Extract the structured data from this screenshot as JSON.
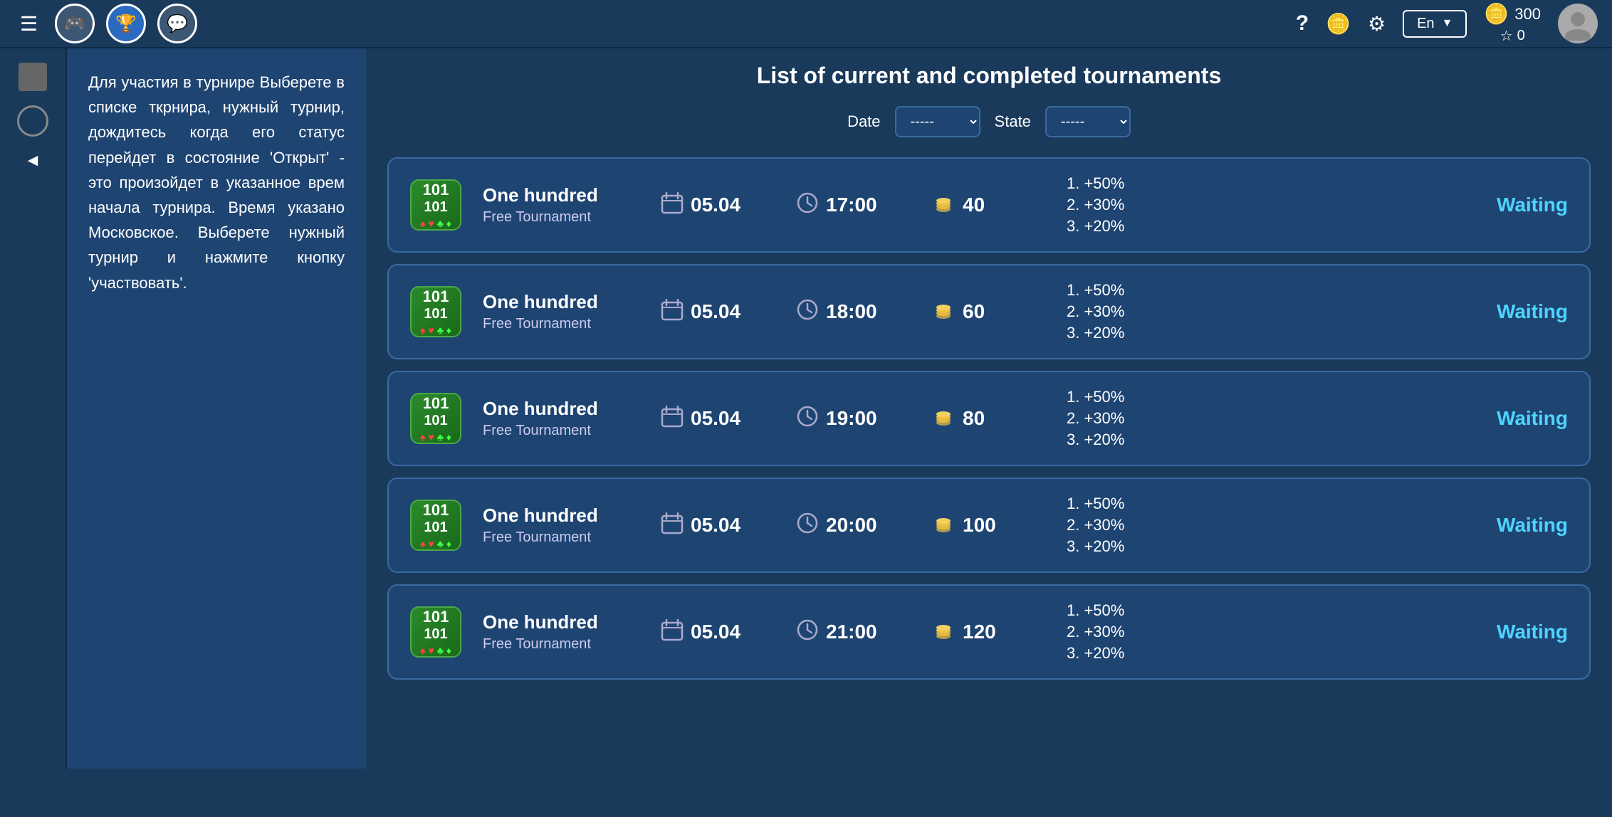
{
  "topnav": {
    "hamburger": "☰",
    "nav_buttons": [
      {
        "id": "games",
        "icon": "🎮",
        "active": false
      },
      {
        "id": "trophy",
        "icon": "🏆",
        "active": true
      },
      {
        "id": "chat",
        "icon": "💬",
        "active": false
      }
    ],
    "help_icon": "?",
    "wallet_icon": "💰",
    "settings_icon": "⚙",
    "lang": "En",
    "coins": "300",
    "stars": "0",
    "coins_icon": "🪙",
    "star_icon": "☆"
  },
  "sidebar": {
    "icons": [
      "■",
      "◯",
      "◄"
    ]
  },
  "help_panel": {
    "text": "Для участия в турнире Выберете в списке ткрнира, нужный турнир, дождитесь когда его статус перейдет в состояние 'Открыт' - это произойдет в указанное врем начала турнира. Время указано Московское. Выберете нужный турнир и нажмите кнопку 'участвовать'."
  },
  "main": {
    "title": "List of current and completed tournaments",
    "filters": {
      "date_label": "Date",
      "date_value": "-----",
      "state_label": "State",
      "state_value": "-----"
    },
    "tournaments": [
      {
        "id": 1,
        "name": "One hundred",
        "type": "Free Tournament",
        "date": "05.04",
        "time": "17:00",
        "coins": "40",
        "prize1": "1. +50%",
        "prize2": "2. +30%",
        "prize3": "3. +20%",
        "status": "Waiting"
      },
      {
        "id": 2,
        "name": "One hundred",
        "type": "Free Tournament",
        "date": "05.04",
        "time": "18:00",
        "coins": "60",
        "prize1": "1. +50%",
        "prize2": "2. +30%",
        "prize3": "3. +20%",
        "status": "Waiting"
      },
      {
        "id": 3,
        "name": "One hundred",
        "type": "Free Tournament",
        "date": "05.04",
        "time": "19:00",
        "coins": "80",
        "prize1": "1. +50%",
        "prize2": "2. +30%",
        "prize3": "3. +20%",
        "status": "Waiting"
      },
      {
        "id": 4,
        "name": "One hundred",
        "type": "Free Tournament",
        "date": "05.04",
        "time": "20:00",
        "coins": "100",
        "prize1": "1. +50%",
        "prize2": "2. +30%",
        "prize3": "3. +20%",
        "status": "Waiting"
      },
      {
        "id": 5,
        "name": "One hundred",
        "type": "Free Tournament",
        "date": "05.04",
        "time": "21:00",
        "coins": "120",
        "prize1": "1. +50%",
        "prize2": "2. +30%",
        "prize3": "3. +20%",
        "status": "Waiting"
      }
    ]
  }
}
